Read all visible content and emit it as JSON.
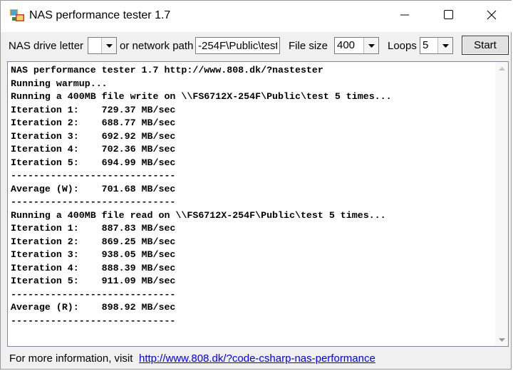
{
  "window": {
    "title": "NAS performance tester 1.7"
  },
  "icons": {
    "app": "nas-app-icon",
    "minimize": "minimize-icon",
    "maximize": "maximize-icon",
    "close": "close-icon",
    "dropdown": "chevron-down-icon"
  },
  "toolbar": {
    "drive_label": "NAS drive letter",
    "drive_value": "",
    "path_label": "or network path",
    "path_value": "-254F\\Public\\test",
    "filesize_label": "File size",
    "filesize_value": "400",
    "loops_label": "Loops",
    "loops_value": "5",
    "start_label": "Start"
  },
  "output": {
    "lines": [
      "NAS performance tester 1.7 http://www.808.dk/?nastester",
      "Running warmup...",
      "Running a 400MB file write on \\\\FS6712X-254F\\Public\\test 5 times...",
      "Iteration 1:    729.37 MB/sec",
      "Iteration 2:    688.77 MB/sec",
      "Iteration 3:    692.92 MB/sec",
      "Iteration 4:    702.36 MB/sec",
      "Iteration 5:    694.99 MB/sec",
      "-----------------------------",
      "Average (W):    701.68 MB/sec",
      "-----------------------------",
      "Running a 400MB file read on \\\\FS6712X-254F\\Public\\test 5 times...",
      "Iteration 1:    887.83 MB/sec",
      "Iteration 2:    869.25 MB/sec",
      "Iteration 3:    938.05 MB/sec",
      "Iteration 4:    888.39 MB/sec",
      "Iteration 5:    911.09 MB/sec",
      "-----------------------------",
      "Average (R):    898.92 MB/sec",
      "-----------------------------"
    ]
  },
  "footer": {
    "info_text": "For more information, visit",
    "link_text": "http://www.808.dk/?code-csharp-nas-performance"
  }
}
